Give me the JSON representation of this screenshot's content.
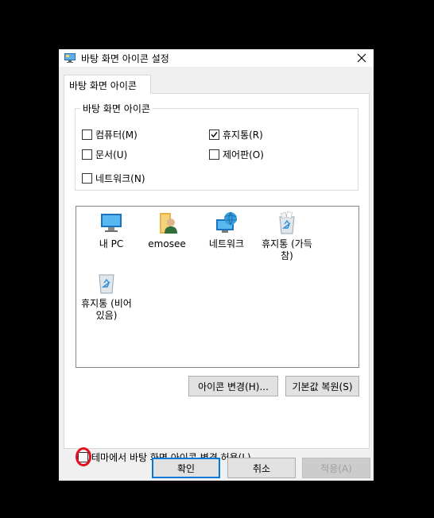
{
  "window": {
    "title": "바탕 화면 아이콘 설정",
    "close_label": "✕"
  },
  "tab": {
    "label": "바탕 화면 아이콘"
  },
  "group": {
    "legend": "바탕 화면 아이콘",
    "checkboxes": [
      {
        "label": "컴퓨터(M)",
        "checked": false
      },
      {
        "label": "휴지통(R)",
        "checked": true
      },
      {
        "label": "문서(U)",
        "checked": false
      },
      {
        "label": "제어판(O)",
        "checked": false
      },
      {
        "label": "네트워크(N)",
        "checked": false
      }
    ]
  },
  "icons": [
    {
      "label": "내 PC",
      "icon": "computer-icon"
    },
    {
      "label": "emosee",
      "icon": "user-folder-icon"
    },
    {
      "label": "네트워크",
      "icon": "network-icon"
    },
    {
      "label": "휴지통 (가득 참)",
      "icon": "recycle-bin-full-icon"
    },
    {
      "label": "휴지통 (비어 있음)",
      "icon": "recycle-bin-empty-icon"
    }
  ],
  "buttons": {
    "change_icon": "아이콘 변경(H)...",
    "restore_default": "기본값 복원(S)",
    "ok": "확인",
    "cancel": "취소",
    "apply": "적용(A)"
  },
  "theme_checkbox": {
    "label": "테마에서 바탕 화면 아이콘 변경 허용(L)",
    "checked": false
  },
  "colors": {
    "accent": "#0078d7",
    "annotation": "#e01020",
    "background": "#000000"
  }
}
